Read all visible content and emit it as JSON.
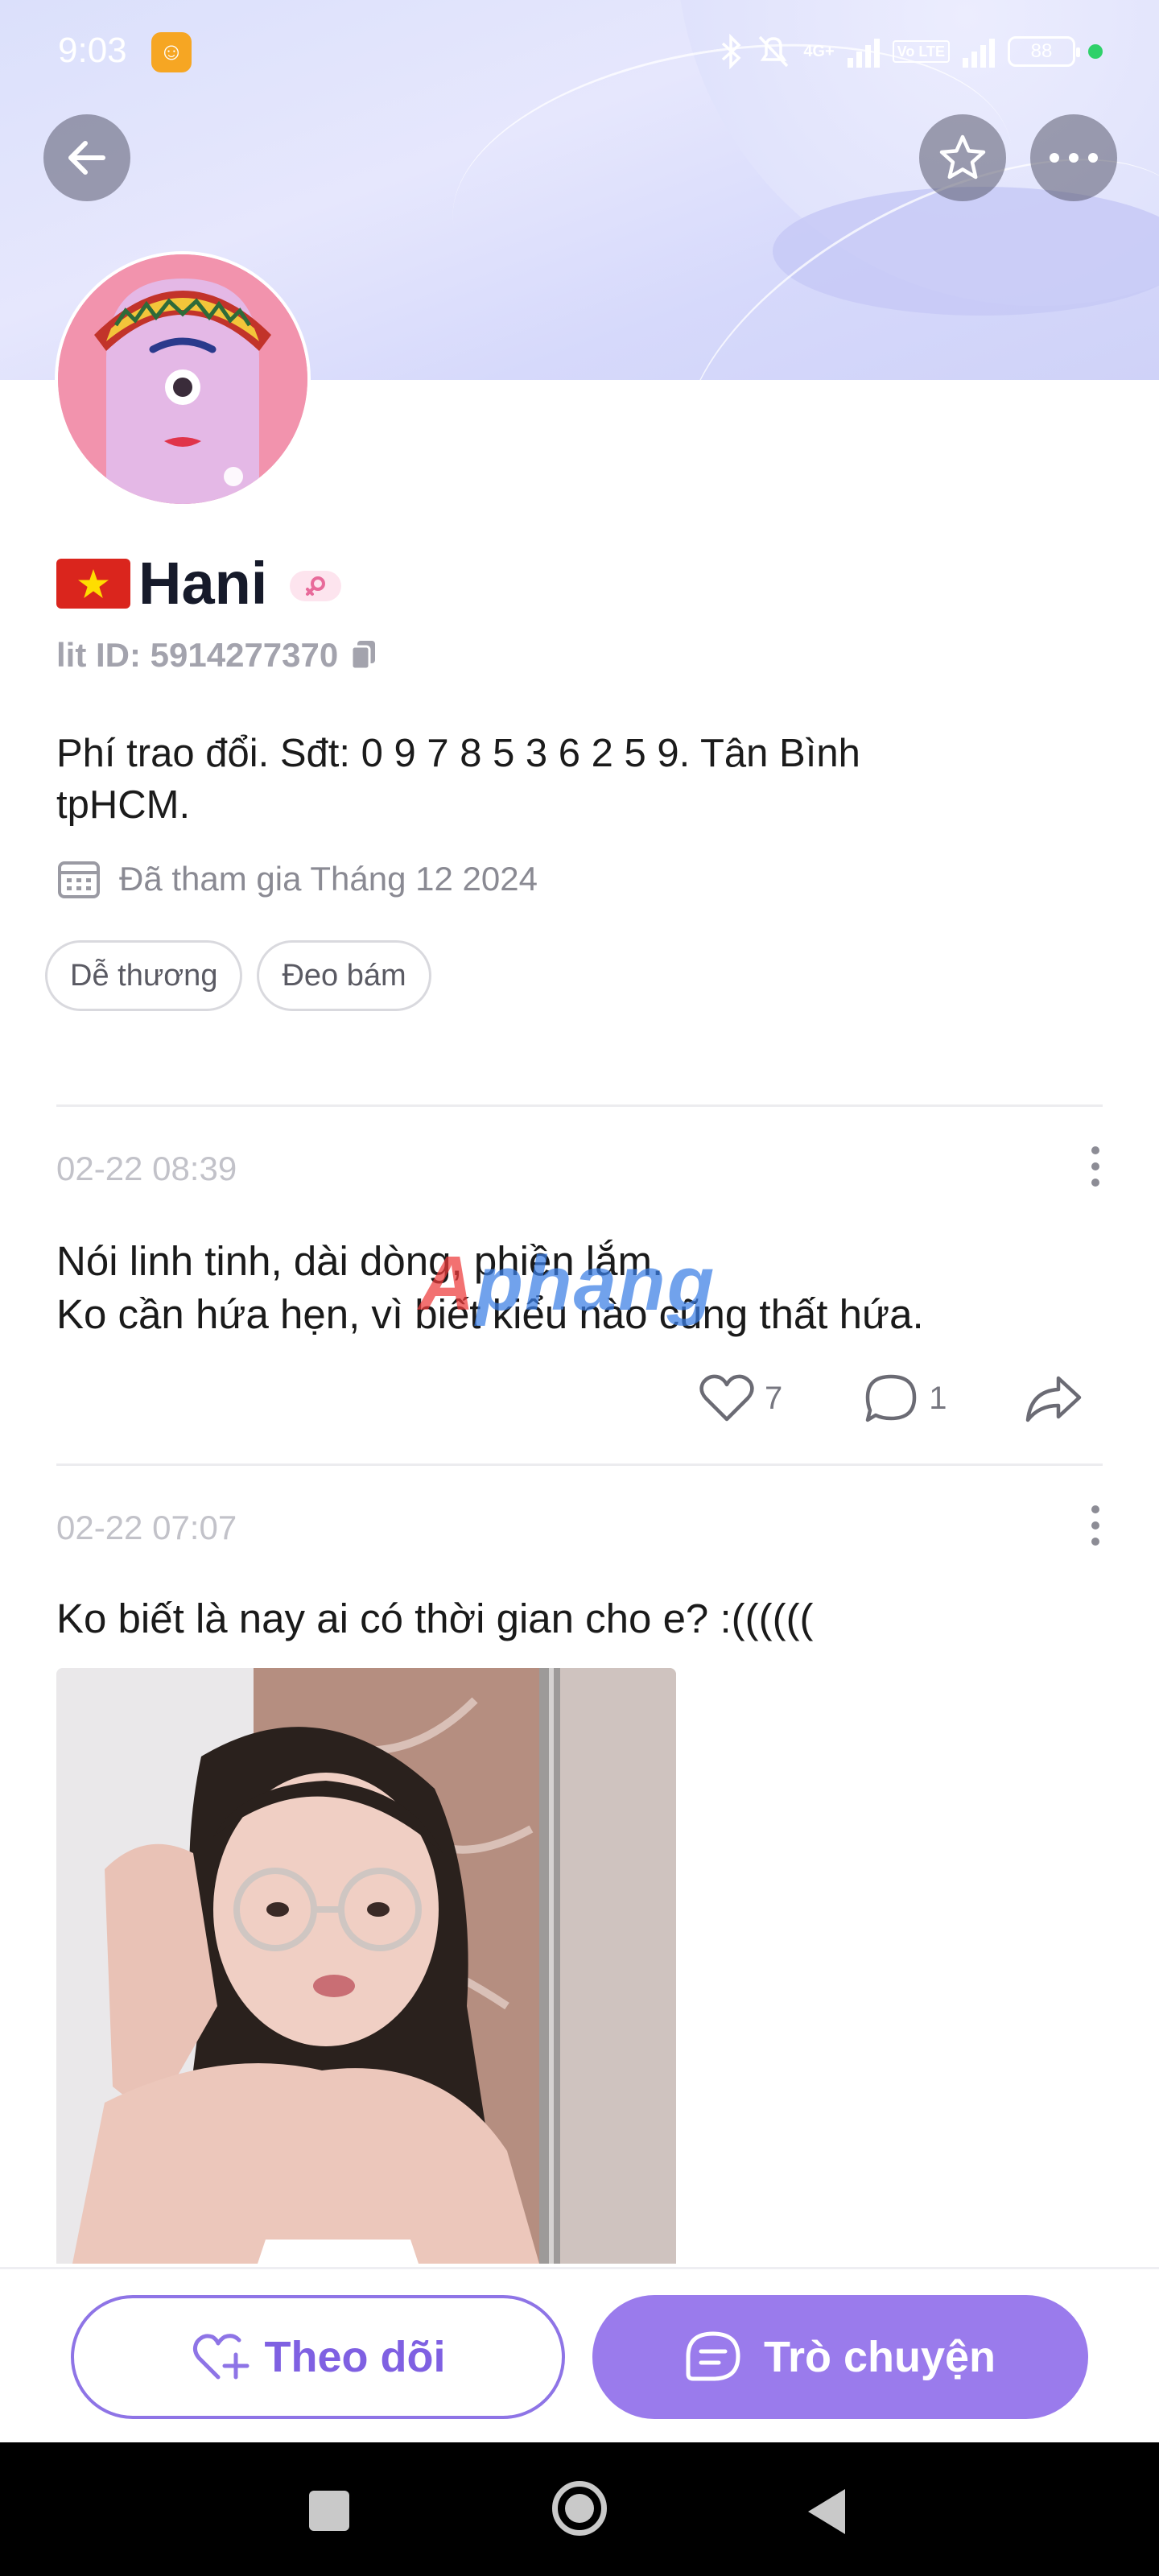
{
  "status_bar": {
    "time": "9:03",
    "network": "4G+",
    "volte": "Vo LTE",
    "battery": "88"
  },
  "header": {
    "back_icon": "arrow-left-icon",
    "star_icon": "star-outline-icon",
    "more_icon": "more-horizontal-icon"
  },
  "profile": {
    "name": "Hani",
    "flag": "vietnam-flag",
    "gender_icon": "female-icon",
    "lit_id": "lit ID: 5914277370",
    "bio": "Phí trao đổi. Sđt: 0 9 7 8 5 3 6 2 5 9. Tân Bình tpHCM.",
    "joined": "Đã tham gia Tháng 12 2024",
    "tags": [
      "Dễ thương",
      "Đeo bám"
    ]
  },
  "posts": [
    {
      "date": "02-22 08:39",
      "text_line1": "Nói linh tinh, dài dòng, phiền lắm.",
      "text_line2": "Ko cần hứa hẹn, vì biết kiểu nào cũng thất hứa.",
      "likes": "7",
      "comments": "1"
    },
    {
      "date": "02-22 07:07",
      "text": "Ko biết là nay ai có thời gian cho e? :(((((("
    }
  ],
  "watermark": "Aphang",
  "bottom_bar": {
    "follow_label": "Theo dõi",
    "chat_label": "Trò chuyện"
  },
  "colors": {
    "accent": "#9a7bec",
    "accent_text": "#7f60e2"
  }
}
